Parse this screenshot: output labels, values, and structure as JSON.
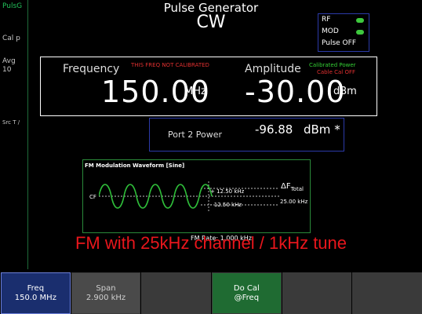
{
  "sidebar": {
    "top": "PulsG",
    "items": [
      "Cal p",
      "Avg",
      "10",
      "Src T /"
    ]
  },
  "header": {
    "title": "Pulse Generator",
    "mode": "CW"
  },
  "status": {
    "rf": "RF",
    "mod": "MOD",
    "pulse": "Pulse OFF"
  },
  "frequency": {
    "label": "Frequency",
    "warning": "THIS FREQ NOT CALIBRATED",
    "value": "150.00",
    "unit": "MHz"
  },
  "amplitude": {
    "label": "Amplitude",
    "cal_power": "Calibrated Power",
    "cal_status": "Cable Cal OFF",
    "value": "-30.00",
    "unit": "dBm"
  },
  "port2": {
    "label": "Port 2 Power",
    "value": "-96.88",
    "unit": "dBm *"
  },
  "fm": {
    "title": "FM Modulation   Waveform  [Sine]",
    "cf": "CF",
    "plus": "+ 12.50 kHz",
    "minus": "- 12.50 kHz",
    "delta": "ΔF",
    "total": "Total",
    "total_value": "25.00 kHz",
    "rate": "FM Rate:  1.000 kHz"
  },
  "overlay": "FM with 25kHz channel / 1kHz tune",
  "softkeys": [
    {
      "line1": "Freq",
      "line2": "150.0 MHz"
    },
    {
      "line1": "Span",
      "line2": "2.900 kHz"
    },
    {
      "line1": "",
      "line2": ""
    },
    {
      "line1": "Do Cal",
      "line2": "@Freq"
    },
    {
      "line1": "",
      "line2": ""
    },
    {
      "line1": "",
      "line2": ""
    }
  ]
}
